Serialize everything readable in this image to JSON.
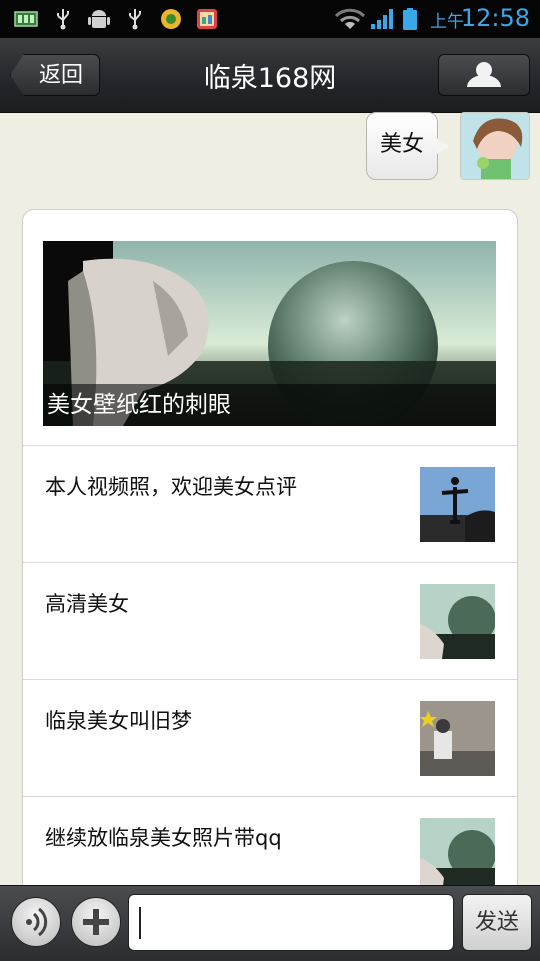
{
  "status_bar": {
    "period": "上午",
    "time": "12:58",
    "icons": [
      "battery-saver-icon",
      "usb-icon",
      "android-debug-icon",
      "usb-icon",
      "app-icon",
      "notification-app-icon",
      "wifi-icon",
      "signal-icon",
      "battery-icon"
    ]
  },
  "header": {
    "back_label": "返回",
    "title": "临泉168网",
    "profile_icon": "user-profile-icon"
  },
  "sent_message": {
    "text": "美女"
  },
  "news_card": {
    "hero_caption": "美女壁纸红的刺眼",
    "items": [
      {
        "title": "本人视频照，欢迎美女点评"
      },
      {
        "title": "高清美女"
      },
      {
        "title": "临泉美女叫旧梦"
      },
      {
        "title": "继续放临泉美女照片带qq"
      }
    ]
  },
  "input_bar": {
    "voice_icon": "voice-icon",
    "plus_icon": "plus-icon",
    "input_value": "",
    "send_label": "发送"
  }
}
